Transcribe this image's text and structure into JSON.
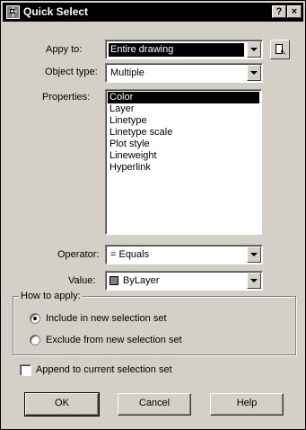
{
  "window": {
    "title": "Quick Select",
    "help_btn": "?",
    "close_btn": "×"
  },
  "apply_to": {
    "label": "Appy to:",
    "value": "Entire drawing"
  },
  "object_type": {
    "label": "Object type:",
    "value": "Multiple"
  },
  "properties": {
    "label": "Properties:",
    "items": [
      "Color",
      "Layer",
      "Linetype",
      "Linetype scale",
      "Plot style",
      "Lineweight",
      "Hyperlink"
    ],
    "selected": "Color"
  },
  "operator": {
    "label": "Operator:",
    "value": "= Equals"
  },
  "value": {
    "label": "Value:",
    "value": "ByLayer",
    "swatch_color": "#808080"
  },
  "how_to_apply": {
    "title": "How to apply:",
    "include": "Include in new selection set",
    "exclude": "Exclude from new selection set",
    "selected": "include"
  },
  "append": {
    "label": "Append to current selection set",
    "checked": false
  },
  "buttons": {
    "ok": "OK",
    "cancel": "Cancel",
    "help": "Help"
  }
}
